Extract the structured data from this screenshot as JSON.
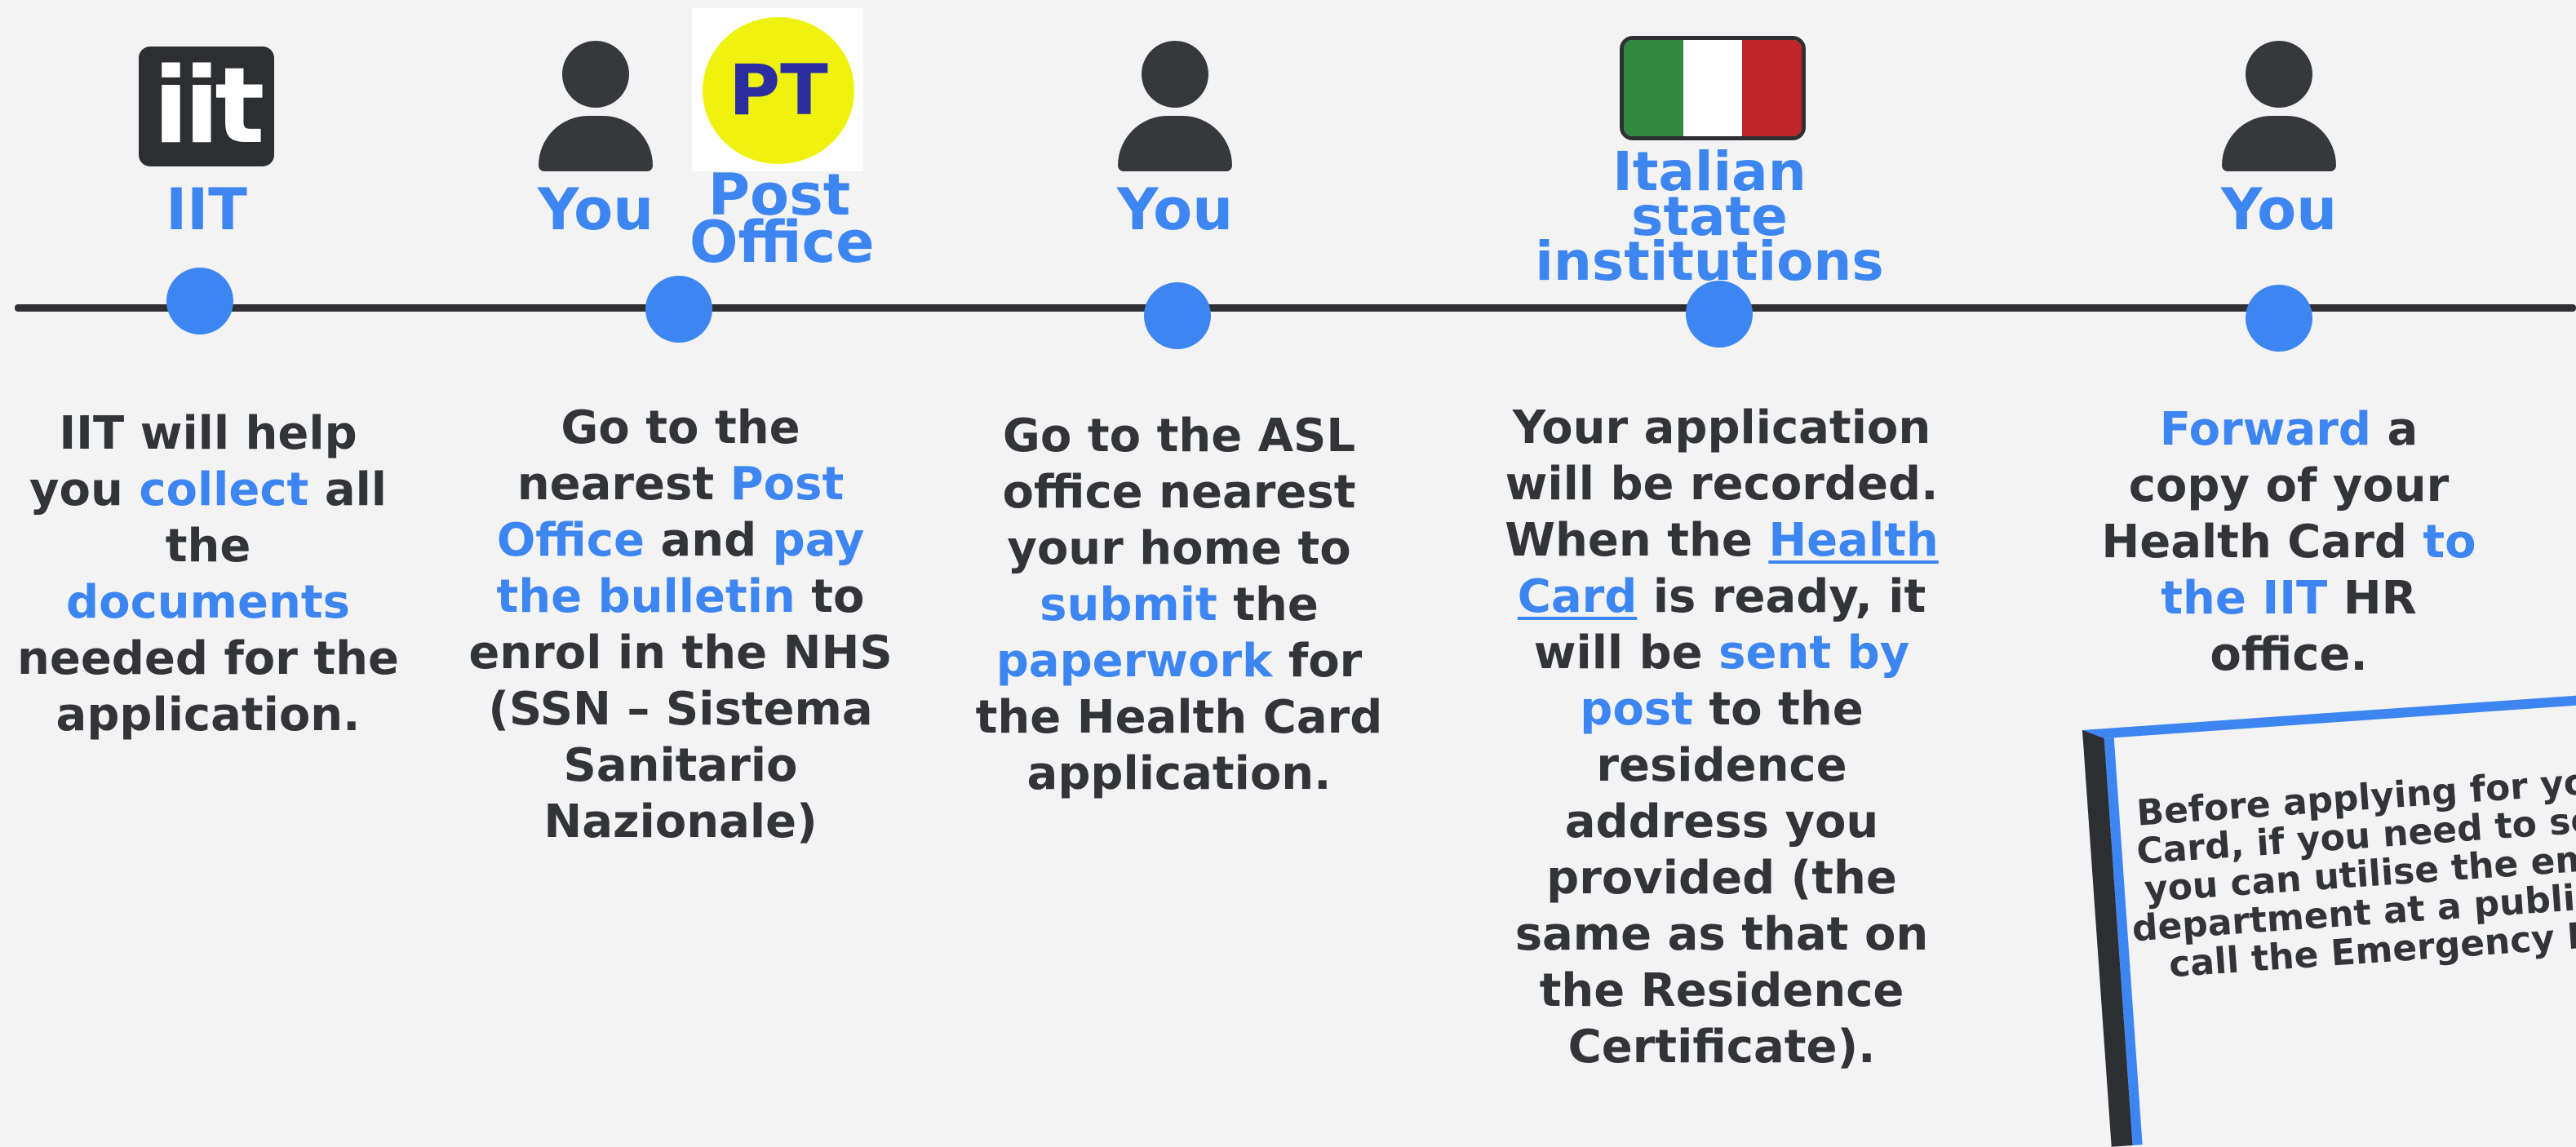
{
  "steps": [
    {
      "actor": "IIT",
      "description": [
        {
          "text": "IIT will help you ",
          "style": "n"
        },
        {
          "text": "collect",
          "style": "h"
        },
        {
          "text": " all the ",
          "style": "n"
        },
        {
          "text": "documents",
          "style": "h"
        },
        {
          "text": " needed for the application.",
          "style": "n"
        }
      ]
    },
    {
      "actor": "You",
      "actor2": "Post Office",
      "description": [
        {
          "text": "Go to the nearest ",
          "style": "n"
        },
        {
          "text": "Post Office",
          "style": "h"
        },
        {
          "text": " and ",
          "style": "n"
        },
        {
          "text": "pay the bulletin",
          "style": "h"
        },
        {
          "text": " to enrol in the NHS (SSN – Sistema Sanitario Nazionale)",
          "style": "n"
        }
      ]
    },
    {
      "actor": "You",
      "description": [
        {
          "text": "Go to the ASL office nearest your home to ",
          "style": "n"
        },
        {
          "text": "submit",
          "style": "h"
        },
        {
          "text": " the ",
          "style": "n"
        },
        {
          "text": "paperwork",
          "style": "h"
        },
        {
          "text": " for the Health Card application.",
          "style": "n"
        }
      ]
    },
    {
      "actor": "Italian state institutions",
      "description": [
        {
          "text": "Your application will be recorded. When the ",
          "style": "n"
        },
        {
          "text": "Health Card",
          "style": "u"
        },
        {
          "text": " is ready, it will be ",
          "style": "n"
        },
        {
          "text": "sent by post",
          "style": "h"
        },
        {
          "text": " to the residence address you provided (the same as that on the Residence Certificate).",
          "style": "n"
        }
      ]
    },
    {
      "actor": "You",
      "description": [
        {
          "text": "Forward",
          "style": "h"
        },
        {
          "text": " a copy of your Health Card ",
          "style": "n"
        },
        {
          "text": "to the IIT",
          "style": "h"
        },
        {
          "text": " HR office.",
          "style": "n"
        }
      ]
    }
  ],
  "logos": {
    "iit": "iit",
    "post_office": "PT"
  },
  "note": [
    "Before applying for you",
    "Card, if you need to see",
    "you can utilise the eme",
    "department at a public h",
    "call the Emergency M"
  ],
  "icons": [
    "person-icon",
    "italian-flag-icon"
  ],
  "colors": {
    "accent": "#3d86f2",
    "text": "#333438",
    "line": "#2e2f33",
    "background": "#f3f3f3",
    "pt_yellow": "#eef20e",
    "pt_blue": "#2b2ea0",
    "flag_green": "#2f8a3f",
    "flag_white": "#ffffff",
    "flag_red": "#c0252a"
  }
}
